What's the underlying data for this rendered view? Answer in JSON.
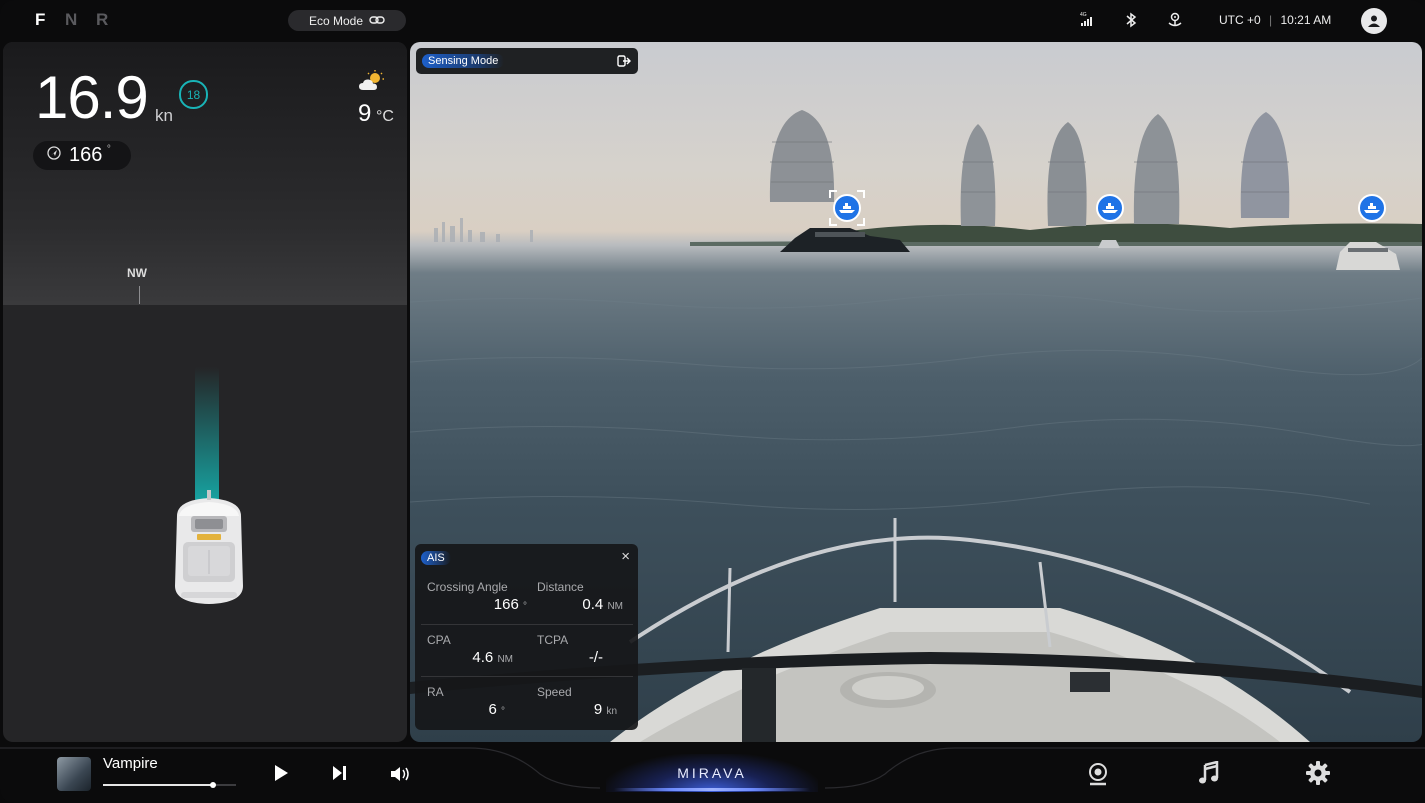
{
  "gears": [
    "F",
    "N",
    "R"
  ],
  "top": {
    "eco_mode": "Eco Mode",
    "utc_offset": "UTC +0",
    "separator": "|",
    "time": "10:21 AM",
    "network_label": "4G"
  },
  "nav": {
    "speed": "16.9",
    "speed_unit": "kn",
    "speed_limit": "18",
    "heading": "166",
    "heading_unit": "°",
    "temperature": "9",
    "temperature_unit": "°C",
    "compass_direction": "NW"
  },
  "camera": {
    "sensing_mode": "Sensing Mode"
  },
  "ais": {
    "tag": "AIS",
    "close": "×",
    "crossing_angle_label": "Crossing Angle",
    "crossing_angle_value": "166",
    "crossing_angle_unit": "°",
    "distance_label": "Distance",
    "distance_value": "0.4",
    "distance_unit": "NM",
    "cpa_label": "CPA",
    "cpa_value": "4.6",
    "cpa_unit": "NM",
    "tcpa_label": "TCPA",
    "tcpa_value": "-/-",
    "ra_label": "RA",
    "ra_value": "6",
    "ra_unit": "°",
    "speed_label": "Speed",
    "speed_value": "9",
    "speed_unit": "kn"
  },
  "media": {
    "song_title": "Vampire",
    "progress_percent": 83
  },
  "brand": {
    "name": "MIRAVA"
  },
  "colors": {
    "accent_teal": "#19b3b6",
    "target_blue": "#1f73e6"
  },
  "icons": {
    "eco": "link-icon",
    "signal": "signal-4g-icon",
    "bluetooth": "bluetooth-icon",
    "anchor": "anchor-location-icon",
    "user": "user-avatar-icon",
    "weather": "partly-cloudy-icon",
    "heading": "navigation-arrow-icon",
    "exit": "exit-icon",
    "boat": "ship-icon",
    "play": "play-icon",
    "next": "skip-next-icon",
    "volume": "volume-icon",
    "camera": "camera-icon",
    "music": "music-icon",
    "settings": "gear-icon"
  }
}
